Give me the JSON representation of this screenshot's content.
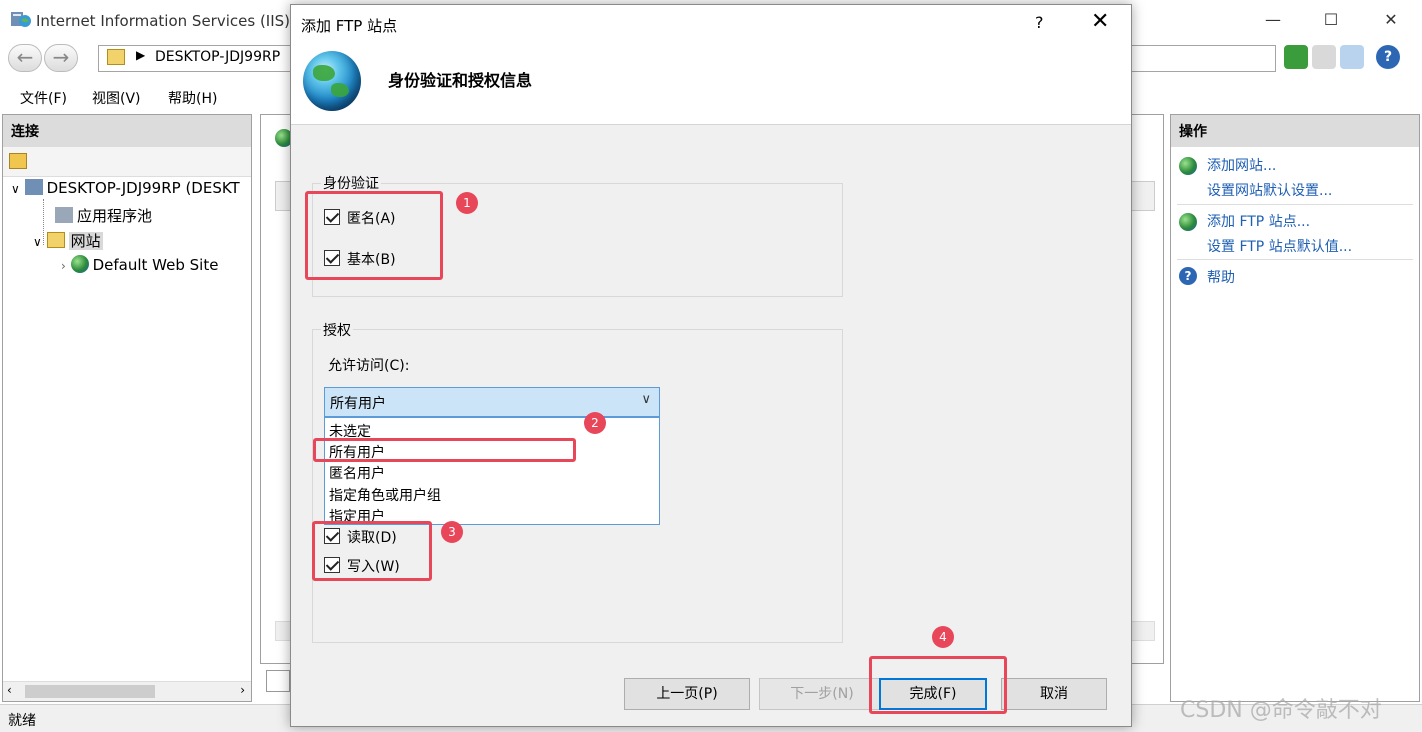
{
  "window": {
    "title": "Internet Information Services (IIS)管",
    "minimize": "—",
    "maximize": "☐",
    "close": "✕"
  },
  "address": {
    "path": "DESKTOP-JDJ99RP"
  },
  "menu": {
    "file": "文件(F)",
    "view": "视图(V)",
    "help": "帮助(H)"
  },
  "connections": {
    "title": "连接",
    "tree": {
      "server": "DESKTOP-JDJ99RP (DESKT",
      "app_pools": "应用程序池",
      "sites": "网站",
      "default_site": "Default Web Site"
    }
  },
  "actions": {
    "title": "操作",
    "add_website": "添加网站...",
    "set_website_defaults": "设置网站默认设置...",
    "add_ftp_site": "添加 FTP 站点...",
    "set_ftp_defaults": "设置 FTP 站点默认值...",
    "help": "帮助"
  },
  "status": {
    "text": "就绪"
  },
  "dialog": {
    "title": "添加 FTP 站点",
    "help": "?",
    "close": "✕",
    "heading": "身份验证和授权信息",
    "auth_group": "身份验证",
    "anonymous": "匿名(A)",
    "basic": "基本(B)",
    "authz_group": "授权",
    "allow_access_label": "允许访问(C):",
    "selected_access": "所有用户",
    "access_options": [
      "未选定",
      "所有用户",
      "匿名用户",
      "指定角色或用户组",
      "指定用户"
    ],
    "read": "读取(D)",
    "write": "写入(W)",
    "prev_button": "上一页(P)",
    "next_button": "下一步(N)",
    "finish_button": "完成(F)",
    "cancel_button": "取消"
  },
  "annotations": [
    "1",
    "2",
    "3",
    "4"
  ],
  "watermark": "CSDN @命令敲不对",
  "colors": {
    "annotation_red": "#e8475a",
    "link_blue": "#1e5fb4",
    "select_highlight": "#cce4f7",
    "primary_border": "#0078d7"
  }
}
